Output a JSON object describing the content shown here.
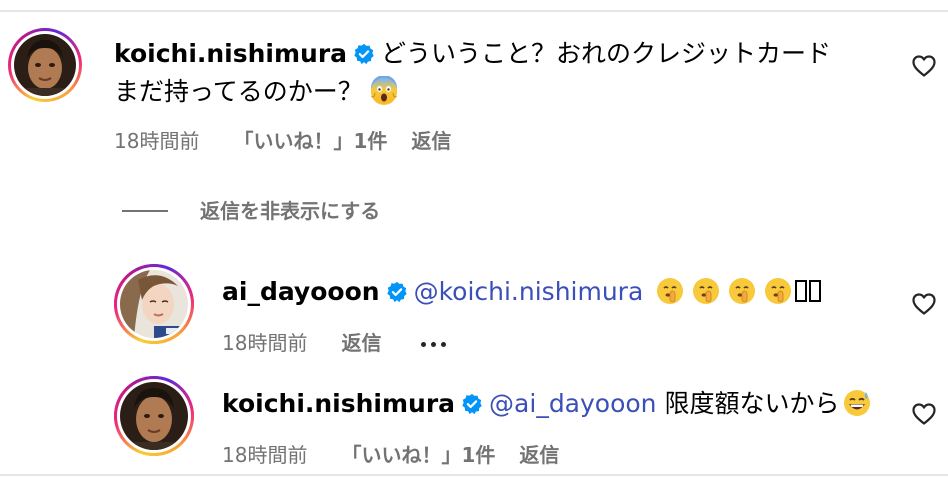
{
  "comment_main": {
    "username": "koichi.nishimura",
    "text_line1": "どういうこと？おれのクレジットカード",
    "text_line2": "まだ持ってるのかー？",
    "emoji": "scream-emoji",
    "time": "18時間前",
    "likes": "「いいね！」1件",
    "reply": "返信"
  },
  "hide_replies_label": "返信を非表示にする",
  "reply_1": {
    "username": "ai_dayooon",
    "mention": "@koichi.nishimura",
    "emojis": [
      "shushing-emoji",
      "shushing-emoji",
      "shushing-emoji",
      "shushing-emoji"
    ],
    "time": "18時間前",
    "reply": "返信"
  },
  "reply_2": {
    "username": "koichi.nishimura",
    "mention": "@ai_dayooon",
    "text": "限度額ないから",
    "emoji": "grinning-sweat-emoji",
    "time": "18時間前",
    "likes": "「いいね！」1件",
    "reply": "返信"
  },
  "colors": {
    "mention": "#3a4fb8",
    "verified": "#0095f6",
    "meta": "#737373"
  }
}
